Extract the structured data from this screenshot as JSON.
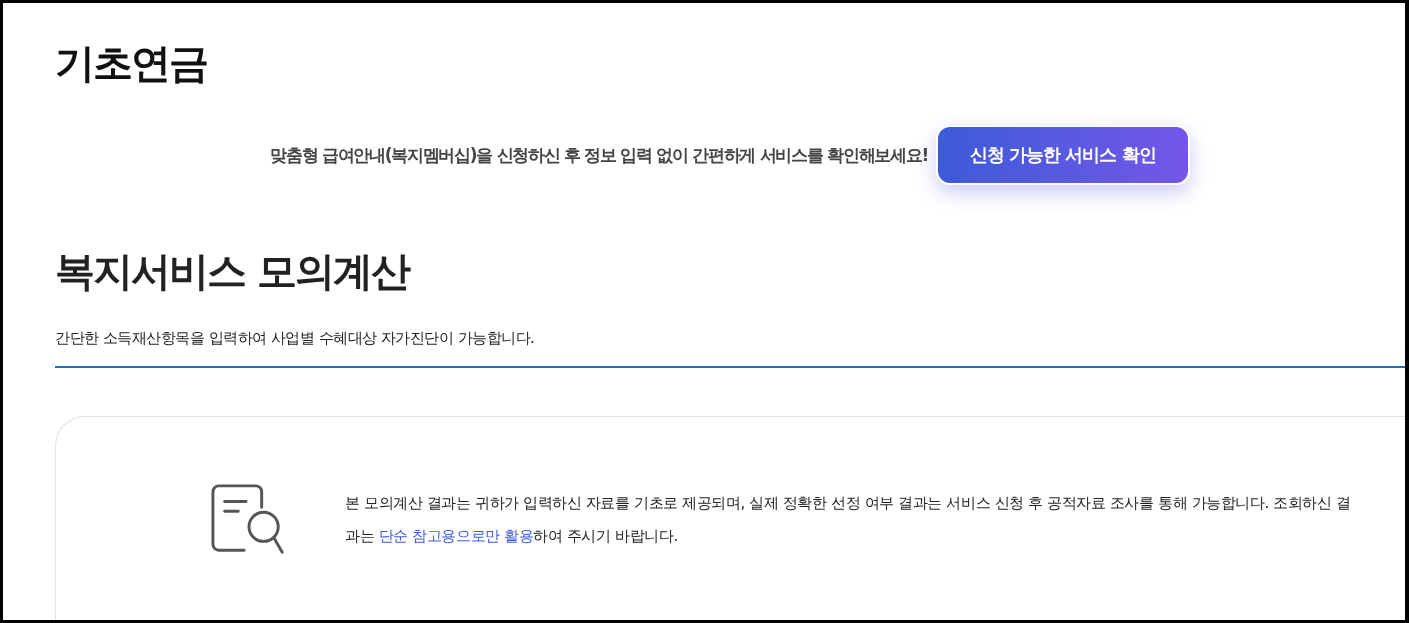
{
  "page": {
    "title": "기초연금"
  },
  "banner": {
    "text": "맞춤형 급여안내(복지멤버십)을 신청하신 후 정보 입력 없이 간편하게 서비스를 확인해보세요!",
    "button": "신청 가능한 서비스 확인"
  },
  "section": {
    "title": "복지서비스 모의계산",
    "description": "간단한 소득재산항목을 입력하여 사업별 수혜대상 자가진단이 가능합니다."
  },
  "notice": {
    "before": "본 모의계산 결과는 귀하가 입력하신 자료를 기초로 제공되며, 실제 정확한 선정 여부 결과는 서비스 신청 후 공적자료 조사를 통해 가능합니다. 조회하신 결과는 ",
    "link": "단순 참고용으로만 활용",
    "after": "하여 주시기 바랍니다."
  }
}
